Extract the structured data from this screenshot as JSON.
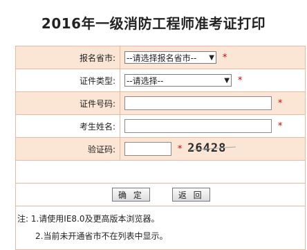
{
  "title": "2016年一级消防工程师准考证打印",
  "form": {
    "province_label": "报名省市:",
    "province_value": "--请选择报名省市--",
    "idtype_label": "证件类型:",
    "idtype_value": "--请选择--",
    "idnum_label": "证件号码:",
    "name_label": "考生姓名:",
    "captcha_label": "验证码:",
    "captcha_text": "26428",
    "required_mark": "*"
  },
  "buttons": {
    "confirm": "确 定",
    "back": "返 回"
  },
  "notes": {
    "line1": "注: 1.请使用IE8.0及更高版本浏览器。",
    "line2": "2.当前未开通省市不在列表中显示。"
  }
}
